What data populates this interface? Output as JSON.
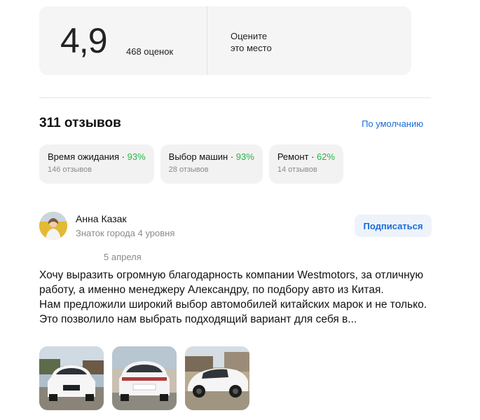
{
  "rating": {
    "value": "4,9",
    "count_label": "468 оценок",
    "rate_prompt": "Оцените\nэто место"
  },
  "reviews": {
    "title": "311 отзывов",
    "sort_label": "По умолчанию"
  },
  "aspects": [
    {
      "name": "Время ожидания",
      "percent": "93%",
      "count": "146 отзывов"
    },
    {
      "name": "Выбор машин",
      "percent": "93%",
      "count": "28 отзывов"
    },
    {
      "name": "Ремонт",
      "percent": "62%",
      "count": "14 отзывов"
    }
  ],
  "review": {
    "author": "Анна Казак",
    "level": "Знаток города 4 уровня",
    "subscribe_label": "Подписаться",
    "date": "5 апреля",
    "paragraph1": "Хочу выразить огромную благодарность компании Westmotors, за отличную работу, а именно менеджеру Александру, по подбору авто из Китая.",
    "paragraph2": "Нам предложили широкий выбор автомобилей китайских марок и не только. Это позволило нам выбрать подходящий вариант для себя в..."
  },
  "colors": {
    "accent": "#1a6cd8",
    "positive": "#2bb34a",
    "card_bg": "#f5f5f5"
  }
}
